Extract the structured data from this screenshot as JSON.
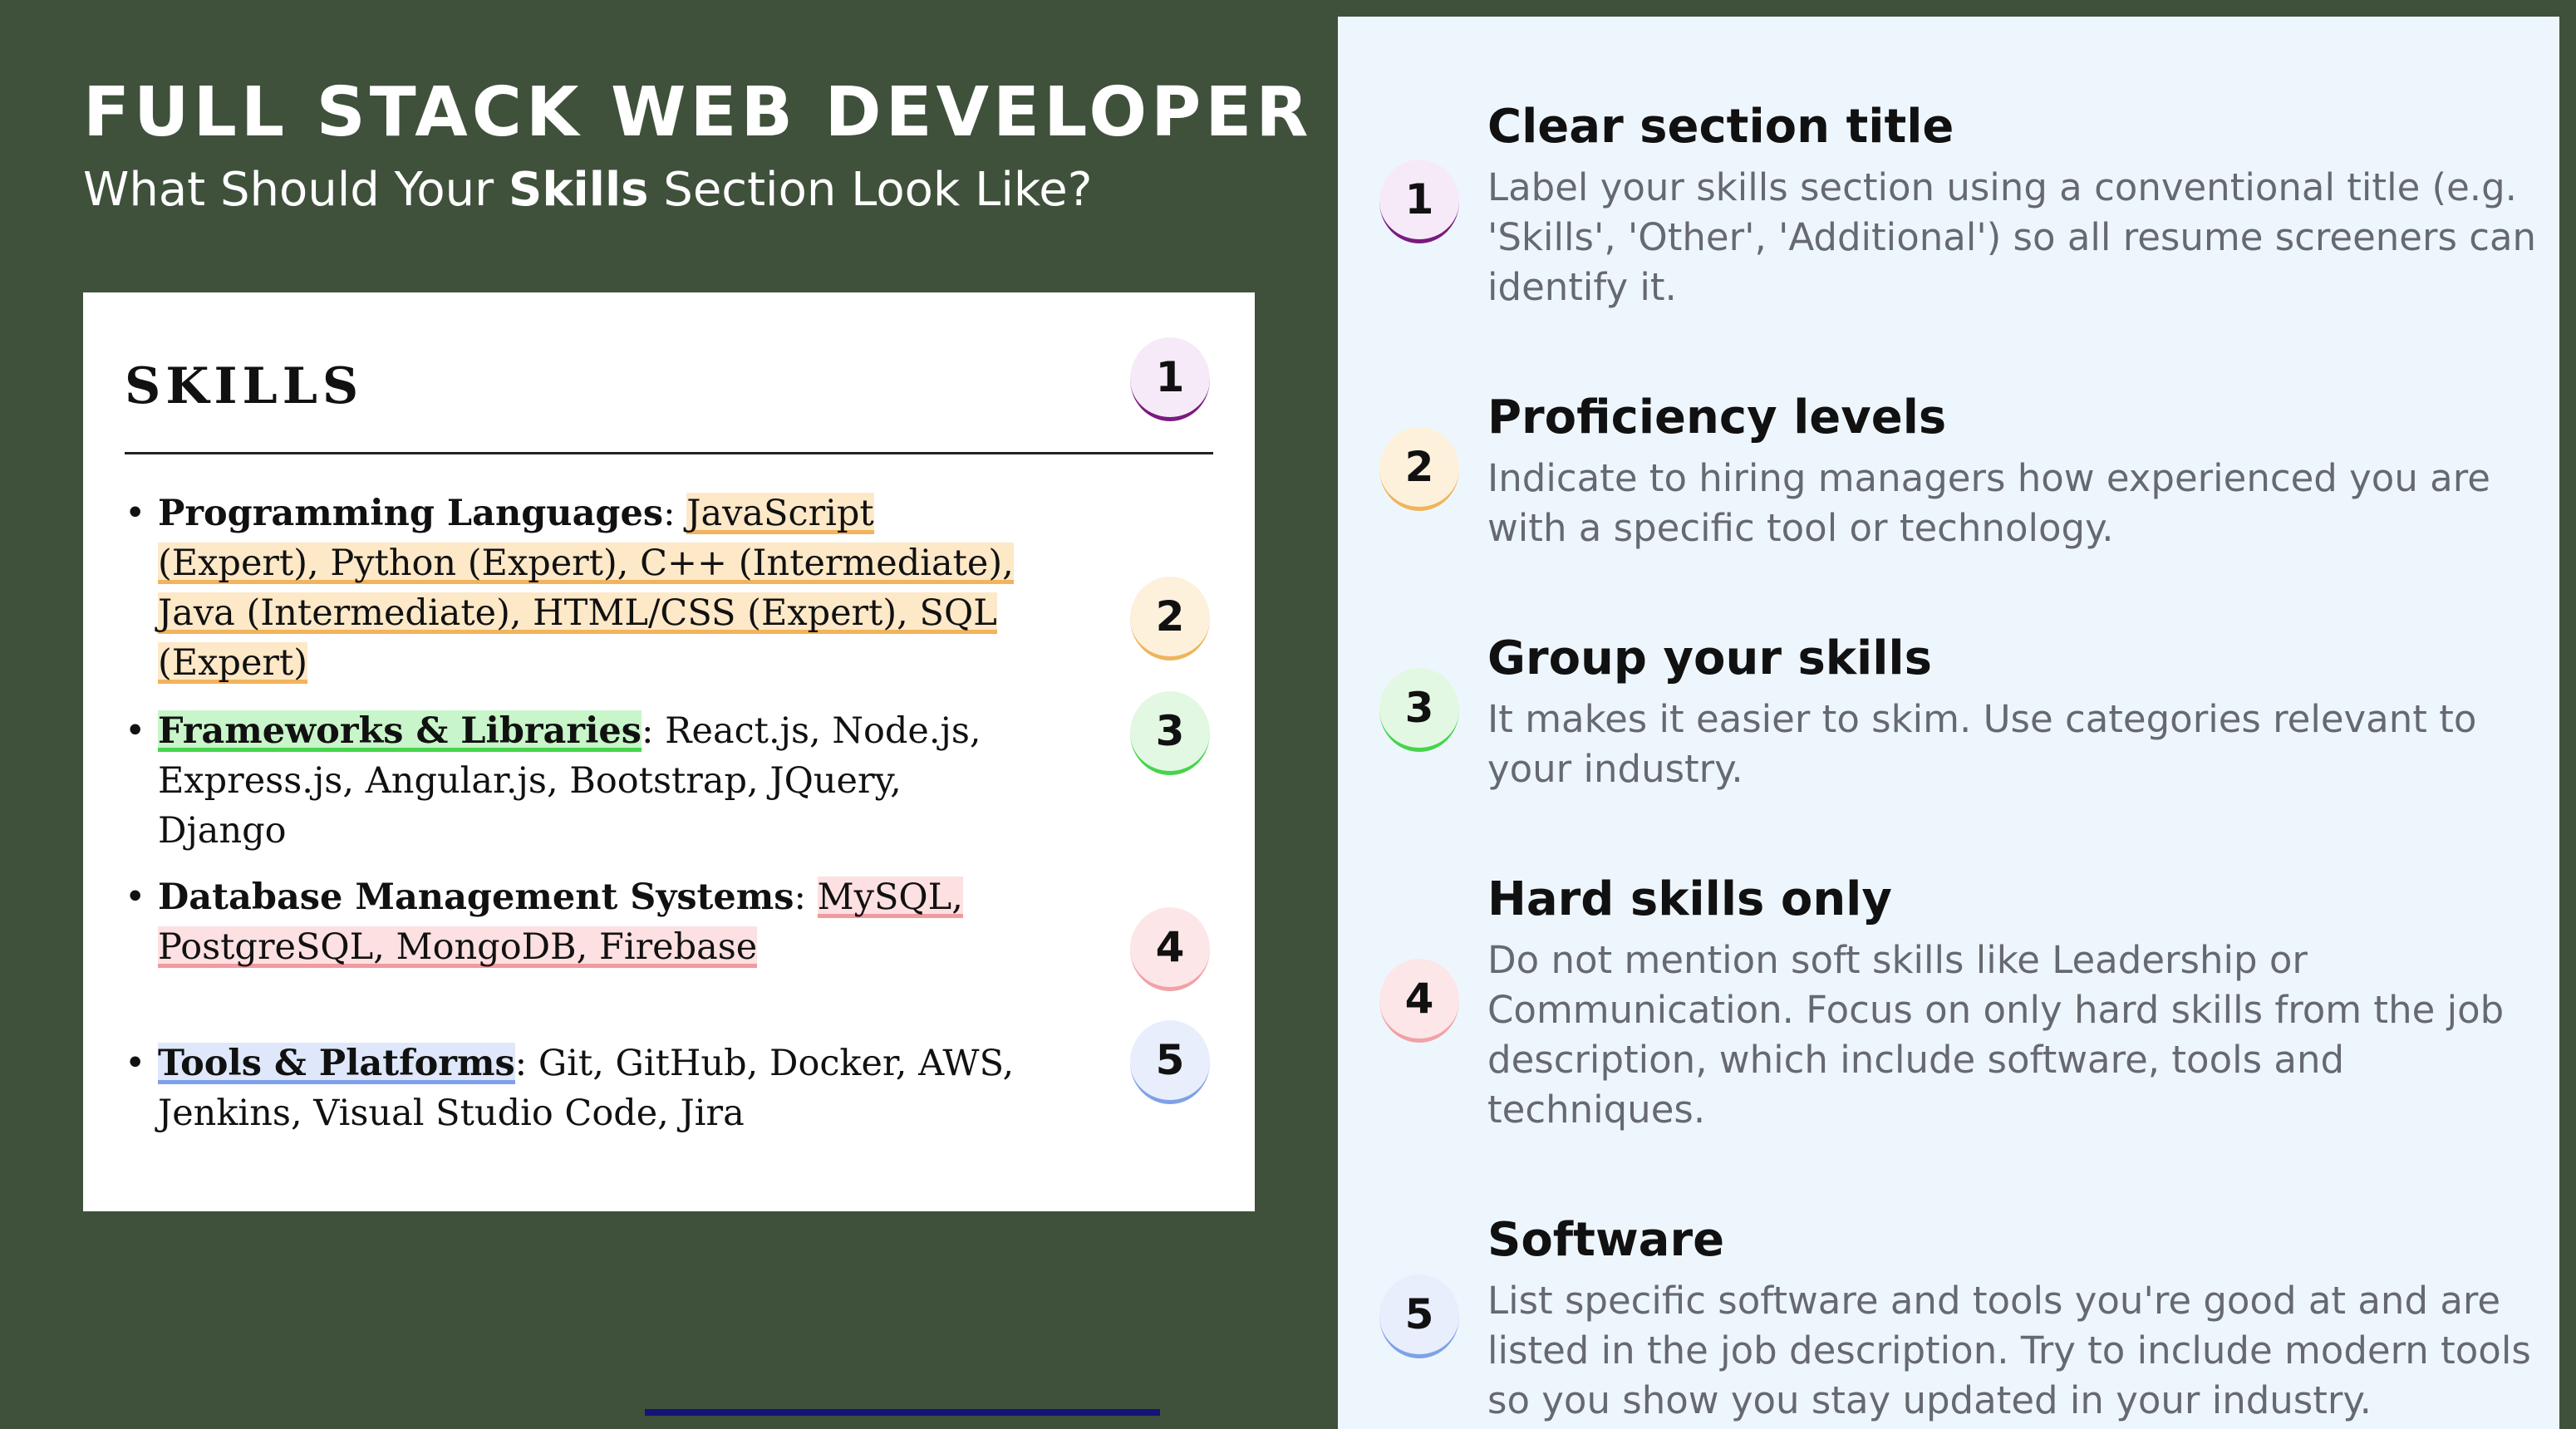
{
  "header": {
    "title": "FULL STACK WEB DEVELOPER",
    "subtitle_before": "What Should Your ",
    "subtitle_bold": "Skills",
    "subtitle_after": " Section Look Like?"
  },
  "resume": {
    "heading": "SKILLS",
    "skills": [
      {
        "label": "Programming Languages",
        "sep": ": ",
        "value": "JavaScript (Expert), Python (Expert), C++ (Intermediate), Java (Intermediate), HTML/CSS (Expert), SQL (Expert)"
      },
      {
        "label": "Frameworks & Libraries",
        "sep": ": ",
        "value": "React.js, Node.js, Express.js, Angular.js, Bootstrap, JQuery, Django"
      },
      {
        "label": "Database Management Systems",
        "sep": ": ",
        "value": "MySQL, PostgreSQL, MongoDB, Firebase"
      },
      {
        "label": "Tools & Platforms",
        "sep": ": ",
        "value": "Git, GitHub, Docker, AWS, Jenkins, Visual Studio Code, Jira"
      }
    ]
  },
  "badges": [
    "1",
    "2",
    "3",
    "4",
    "5"
  ],
  "tips": [
    {
      "title": "Clear section title",
      "desc": "Label your skills section using a conventional title (e.g. 'Skills', 'Other', 'Additional') so all resume screeners can identify it."
    },
    {
      "title": "Proficiency levels",
      "desc": "Indicate to hiring managers how experienced you are with a specific tool or technology."
    },
    {
      "title": "Group your skills",
      "desc": "It makes it easier to skim. Use categories relevant to your industry."
    },
    {
      "title": "Hard skills only",
      "desc": "Do not mention soft skills like Leadership or Communication. Focus on only hard skills from the job description, which include software, tools and techniques."
    },
    {
      "title": "Software",
      "desc": "List specific software and tools you're good at and are listed in the job description. Try to include modern tools so you show you stay updated in your industry."
    }
  ],
  "colors": {
    "background": "#3f513b",
    "panel": "#eef6fd",
    "badge1": "#7a1a7f",
    "badge2": "#f0b45b",
    "badge3": "#46d44b",
    "badge4": "#f0a2a6",
    "badge5": "#7fa1e8"
  }
}
